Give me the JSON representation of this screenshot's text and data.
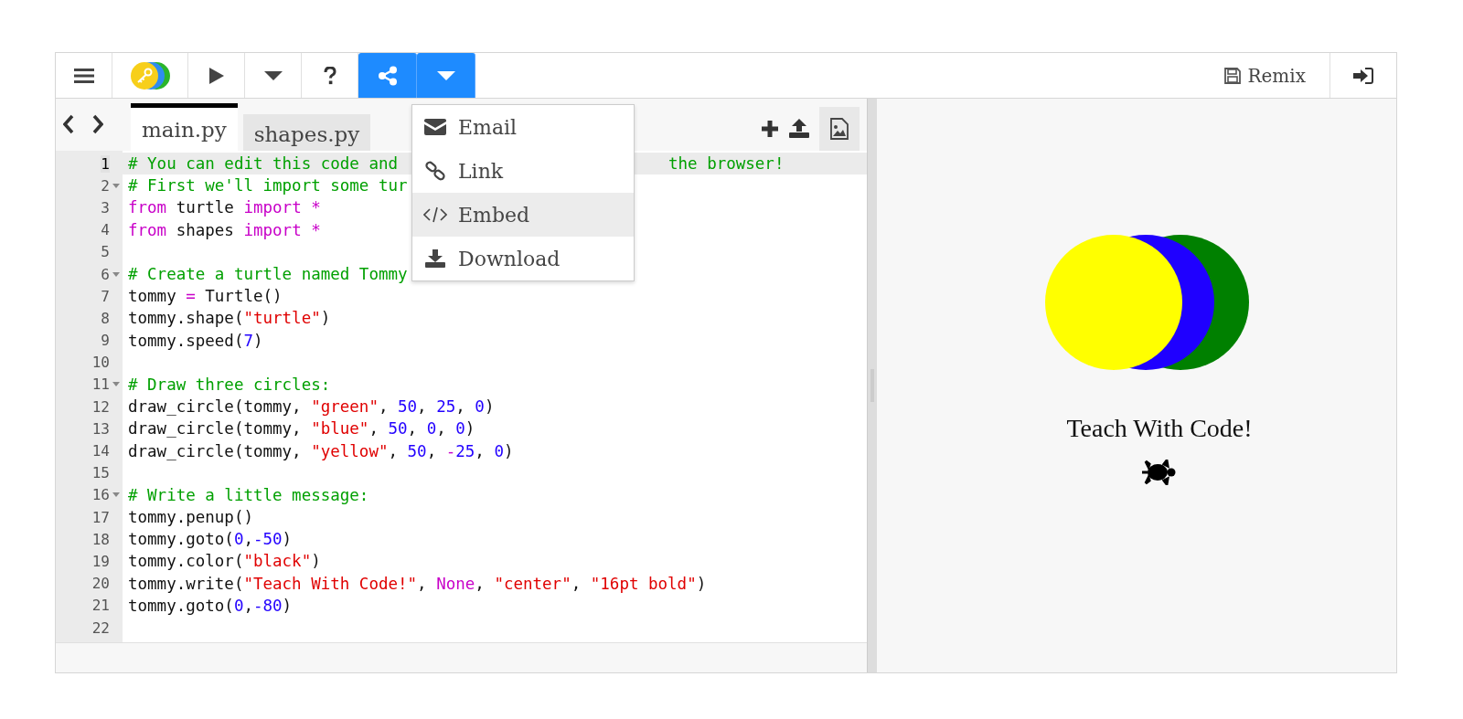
{
  "toolbar": {
    "remix_label": "Remix"
  },
  "share_menu": {
    "open": true,
    "items": [
      {
        "label": "Email",
        "selected": false
      },
      {
        "label": "Link",
        "selected": false
      },
      {
        "label": "Embed",
        "selected": true
      },
      {
        "label": "Download",
        "selected": false
      }
    ]
  },
  "tabs": [
    {
      "label": "main.py",
      "selected": true
    },
    {
      "label": "shapes.py",
      "selected": false
    }
  ],
  "code_lines": [
    {
      "number": "1",
      "active": true,
      "foldable": false,
      "tokens": [
        {
          "kind": "comment",
          "text": "# You can edit this code and"
        },
        {
          "kind": "tail",
          "text": "the browser!"
        }
      ]
    },
    {
      "number": "2",
      "active": false,
      "foldable": true,
      "tokens": [
        {
          "kind": "comment",
          "text": "# First we'll import some tur"
        }
      ]
    },
    {
      "number": "3",
      "active": false,
      "foldable": false,
      "tokens": [
        {
          "kind": "keyword",
          "text": "from"
        },
        {
          "kind": "plain",
          "text": " turtle "
        },
        {
          "kind": "keyword",
          "text": "import *"
        }
      ]
    },
    {
      "number": "4",
      "active": false,
      "foldable": false,
      "tokens": [
        {
          "kind": "keyword",
          "text": "from"
        },
        {
          "kind": "plain",
          "text": " shapes "
        },
        {
          "kind": "keyword",
          "text": "import *"
        }
      ]
    },
    {
      "number": "5",
      "active": false,
      "foldable": false
    },
    {
      "number": "6",
      "active": false,
      "foldable": true,
      "tokens": [
        {
          "kind": "comment",
          "text": "# Create a turtle named Tommy"
        }
      ]
    },
    {
      "number": "7",
      "active": false,
      "foldable": false,
      "tokens": [
        {
          "kind": "plain",
          "text": "tommy "
        },
        {
          "kind": "keyword",
          "text": "="
        },
        {
          "kind": "plain",
          "text": " Turtle()"
        }
      ]
    },
    {
      "number": "8",
      "active": false,
      "foldable": false,
      "tokens": [
        {
          "kind": "plain",
          "text": "tommy.shape("
        },
        {
          "kind": "string",
          "text": "\"turtle\""
        },
        {
          "kind": "plain",
          "text": ")"
        }
      ]
    },
    {
      "number": "9",
      "active": false,
      "foldable": false,
      "tokens": [
        {
          "kind": "plain",
          "text": "tommy.speed("
        },
        {
          "kind": "number",
          "text": "7"
        },
        {
          "kind": "plain",
          "text": ")"
        }
      ]
    },
    {
      "number": "10",
      "active": false,
      "foldable": false
    },
    {
      "number": "11",
      "active": false,
      "foldable": true,
      "tokens": [
        {
          "kind": "comment",
          "text": "# Draw three circles:"
        }
      ]
    },
    {
      "number": "12",
      "active": false,
      "foldable": false,
      "tokens": [
        {
          "kind": "plain",
          "text": "draw_circle(tommy, "
        },
        {
          "kind": "string",
          "text": "\"green\""
        },
        {
          "kind": "plain",
          "text": ", "
        },
        {
          "kind": "number",
          "text": "50"
        },
        {
          "kind": "plain",
          "text": ", "
        },
        {
          "kind": "number",
          "text": "25"
        },
        {
          "kind": "plain",
          "text": ", "
        },
        {
          "kind": "number",
          "text": "0"
        },
        {
          "kind": "plain",
          "text": ")"
        }
      ]
    },
    {
      "number": "13",
      "active": false,
      "foldable": false,
      "tokens": [
        {
          "kind": "plain",
          "text": "draw_circle(tommy, "
        },
        {
          "kind": "string",
          "text": "\"blue\""
        },
        {
          "kind": "plain",
          "text": ", "
        },
        {
          "kind": "number",
          "text": "50"
        },
        {
          "kind": "plain",
          "text": ", "
        },
        {
          "kind": "number",
          "text": "0"
        },
        {
          "kind": "plain",
          "text": ", "
        },
        {
          "kind": "number",
          "text": "0"
        },
        {
          "kind": "plain",
          "text": ")"
        }
      ]
    },
    {
      "number": "14",
      "active": false,
      "foldable": false,
      "tokens": [
        {
          "kind": "plain",
          "text": "draw_circle(tommy, "
        },
        {
          "kind": "string",
          "text": "\"yellow\""
        },
        {
          "kind": "plain",
          "text": ", "
        },
        {
          "kind": "number",
          "text": "50"
        },
        {
          "kind": "plain",
          "text": ", "
        },
        {
          "kind": "keyword",
          "text": "-"
        },
        {
          "kind": "number",
          "text": "25"
        },
        {
          "kind": "plain",
          "text": ", "
        },
        {
          "kind": "number",
          "text": "0"
        },
        {
          "kind": "plain",
          "text": ")"
        }
      ]
    },
    {
      "number": "15",
      "active": false,
      "foldable": false
    },
    {
      "number": "16",
      "active": false,
      "foldable": true,
      "tokens": [
        {
          "kind": "comment",
          "text": "# Write a little message:"
        }
      ]
    },
    {
      "number": "17",
      "active": false,
      "foldable": false,
      "tokens": [
        {
          "kind": "plain",
          "text": "tommy.penup()"
        }
      ]
    },
    {
      "number": "18",
      "active": false,
      "foldable": false,
      "tokens": [
        {
          "kind": "plain",
          "text": "tommy.goto("
        },
        {
          "kind": "number",
          "text": "0"
        },
        {
          "kind": "plain",
          "text": ","
        },
        {
          "kind": "number",
          "text": "-50"
        },
        {
          "kind": "plain",
          "text": ")"
        }
      ]
    },
    {
      "number": "19",
      "active": false,
      "foldable": false,
      "tokens": [
        {
          "kind": "plain",
          "text": "tommy.color("
        },
        {
          "kind": "string",
          "text": "\"black\""
        },
        {
          "kind": "plain",
          "text": ")"
        }
      ]
    },
    {
      "number": "20",
      "active": false,
      "foldable": false,
      "tokens": [
        {
          "kind": "plain",
          "text": "tommy.write("
        },
        {
          "kind": "string",
          "text": "\"Teach With Code!\""
        },
        {
          "kind": "plain",
          "text": ", "
        },
        {
          "kind": "keyword",
          "text": "None"
        },
        {
          "kind": "plain",
          "text": ", "
        },
        {
          "kind": "string",
          "text": "\"center\""
        },
        {
          "kind": "plain",
          "text": ", "
        },
        {
          "kind": "string",
          "text": "\"16pt bold\""
        },
        {
          "kind": "plain",
          "text": ")"
        }
      ]
    },
    {
      "number": "21",
      "active": false,
      "foldable": false,
      "tokens": [
        {
          "kind": "plain",
          "text": "tommy.goto("
        },
        {
          "kind": "number",
          "text": "0"
        },
        {
          "kind": "plain",
          "text": ","
        },
        {
          "kind": "number",
          "text": "-80"
        },
        {
          "kind": "plain",
          "text": ")"
        }
      ]
    },
    {
      "number": "22",
      "active": false,
      "foldable": false
    }
  ],
  "output": {
    "circles": [
      {
        "color": "#008000"
      },
      {
        "color": "#1f00ff"
      },
      {
        "color": "#ffff00"
      }
    ],
    "message": "Teach With Code!"
  }
}
